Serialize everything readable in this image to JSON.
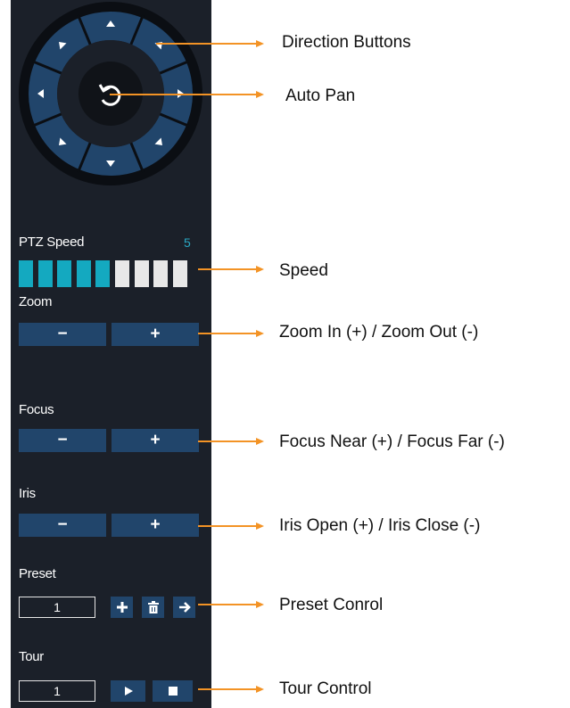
{
  "ptz": {
    "speed_label": "PTZ Speed",
    "speed_value": "5",
    "speed_level": 5,
    "speed_segments": 9,
    "zoom_label": "Zoom",
    "focus_label": "Focus",
    "iris_label": "Iris",
    "minus": "−",
    "plus": "+",
    "preset_label": "Preset",
    "preset_value": "1",
    "tour_label": "Tour",
    "tour_value": "1"
  },
  "annotations": {
    "direction": "Direction Buttons",
    "autopan": "Auto Pan",
    "speed": "Speed",
    "zoom": "Zoom In (+) / Zoom Out (-)",
    "focus": "Focus Near (+) / Focus Far (-)",
    "iris": "Iris Open (+) / Iris Close (-)",
    "preset": "Preset Conrol",
    "tour": "Tour Control"
  },
  "colors": {
    "panel": "#1b2029",
    "button": "#21456b",
    "speed_active": "#14a9c0",
    "speed_inactive": "#e8e8e8",
    "arrow": "#f39325"
  }
}
